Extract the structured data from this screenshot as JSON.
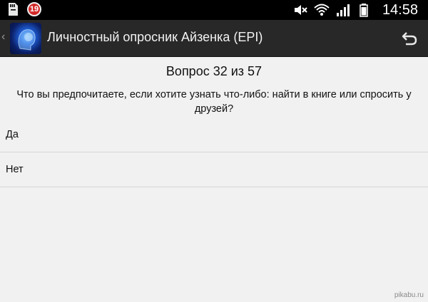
{
  "status_bar": {
    "time": "14:58",
    "notification_count": "19",
    "icons": [
      "sd-card-icon",
      "notification-badge-icon",
      "mute-icon",
      "wifi-icon",
      "signal-icon",
      "battery-icon"
    ]
  },
  "action_bar": {
    "title": "Личностный опросник Айзенка (EPI)",
    "up_caret": "‹",
    "background": "#282828"
  },
  "question": {
    "counter": "Вопрос 32 из 57",
    "text": "Что вы предпочитаете, если хотите узнать что-либо: найти в книге или спросить у друзей?"
  },
  "answers": [
    {
      "label": "Да"
    },
    {
      "label": "Нет"
    }
  ],
  "watermark": "pikabu.ru"
}
